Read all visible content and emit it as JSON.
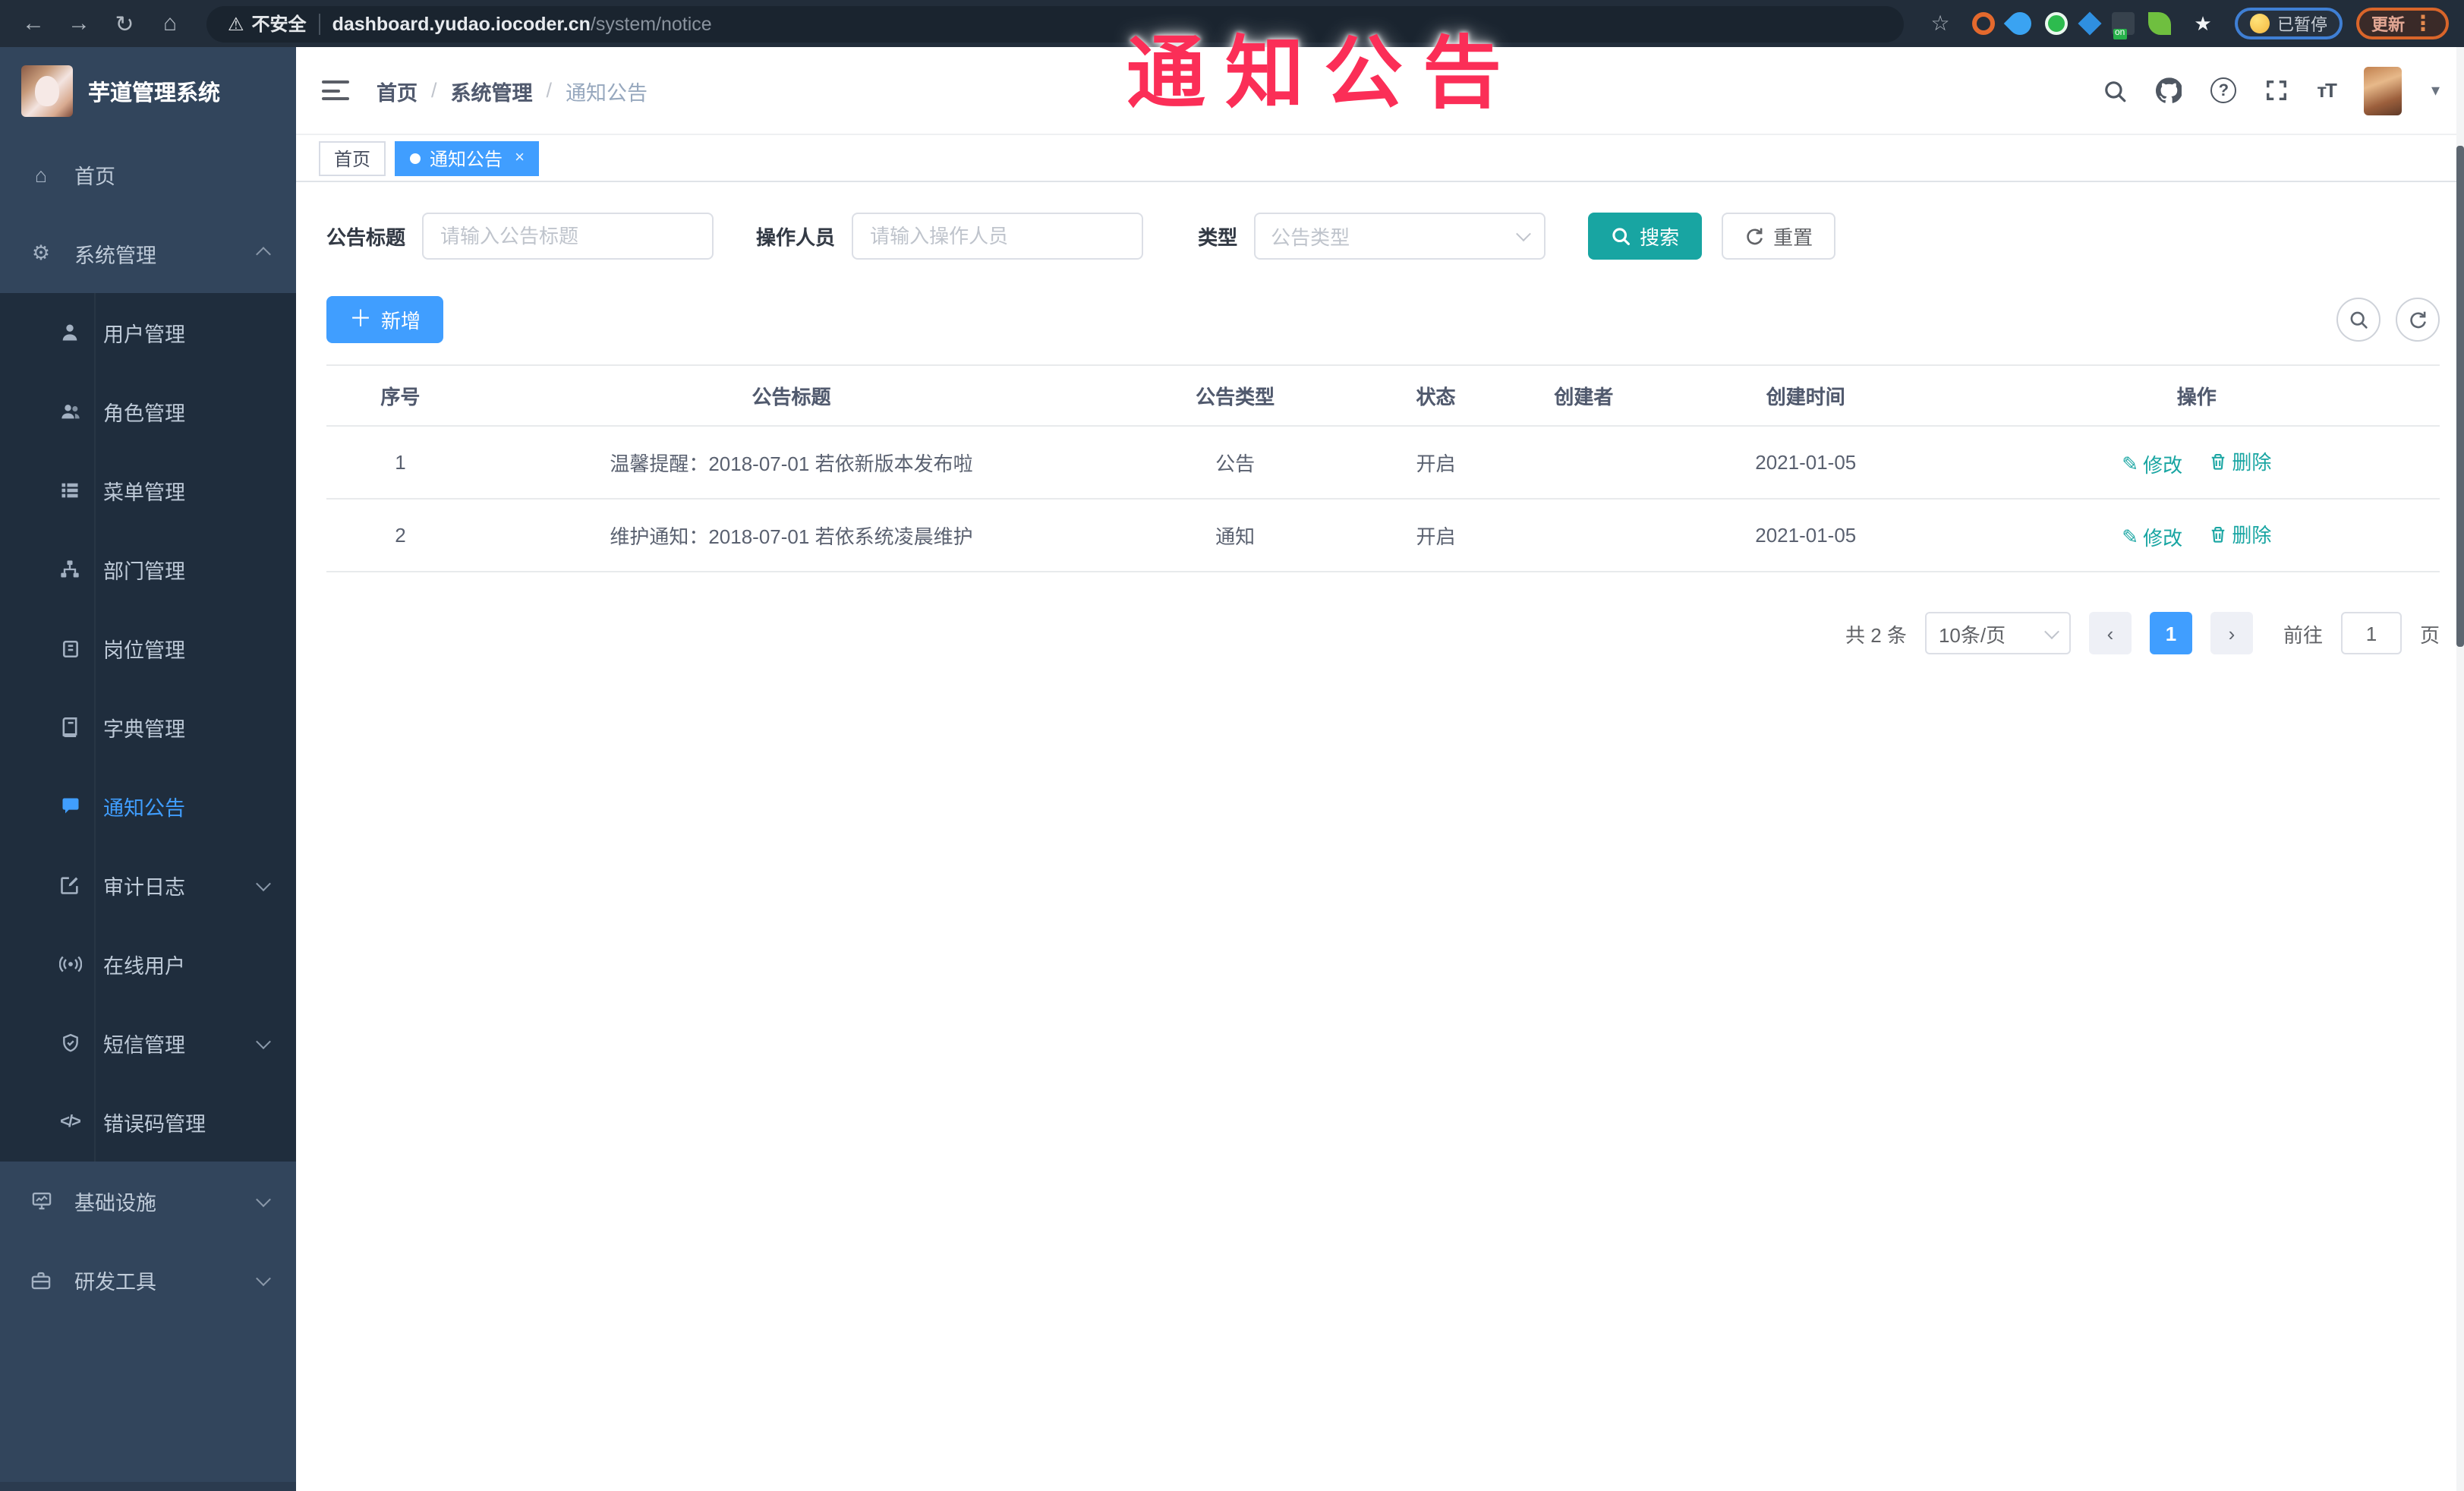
{
  "watermark": {
    "text": "通知公告"
  },
  "browser": {
    "security_label": "不安全",
    "url_host": "dashboard.yudao.iocoder.cn",
    "url_path": "/system/notice",
    "paused_badge": "已暂停",
    "update_button": "更新"
  },
  "sidebar": {
    "app_title": "芋道管理系统",
    "items": [
      {
        "label": "首页",
        "icon": "home-icon"
      },
      {
        "label": "系统管理",
        "icon": "gear-icon",
        "state": "expanded"
      },
      {
        "label": "用户管理",
        "icon": "user-icon"
      },
      {
        "label": "角色管理",
        "icon": "role-icon"
      },
      {
        "label": "菜单管理",
        "icon": "menu-list-icon"
      },
      {
        "label": "部门管理",
        "icon": "org-tree-icon"
      },
      {
        "label": "岗位管理",
        "icon": "post-icon"
      },
      {
        "label": "字典管理",
        "icon": "dict-icon"
      },
      {
        "label": "通知公告",
        "icon": "notice-icon",
        "state": "active"
      },
      {
        "label": "审计日志",
        "icon": "audit-log-icon",
        "state": "collapsed"
      },
      {
        "label": "在线用户",
        "icon": "online-user-icon"
      },
      {
        "label": "短信管理",
        "icon": "sms-icon",
        "state": "collapsed"
      },
      {
        "label": "错误码管理",
        "icon": "error-code-icon"
      },
      {
        "label": "基础设施",
        "icon": "infra-icon",
        "state": "collapsed"
      },
      {
        "label": "研发工具",
        "icon": "devtool-icon",
        "state": "collapsed"
      }
    ]
  },
  "header": {
    "breadcrumb": [
      "首页",
      "系统管理",
      "通知公告"
    ],
    "separator": "/"
  },
  "tabs": {
    "home": "首页",
    "active": "通知公告",
    "close": "×"
  },
  "filters": {
    "title_label": "公告标题",
    "title_placeholder": "请输入公告标题",
    "operator_label": "操作人员",
    "operator_placeholder": "请输入操作人员",
    "type_label": "类型",
    "type_placeholder": "公告类型",
    "search_label": "搜索",
    "reset_label": "重置"
  },
  "toolbar": {
    "add_label": "新增"
  },
  "table": {
    "headers": [
      "序号",
      "公告标题",
      "公告类型",
      "状态",
      "创建者",
      "创建时间",
      "操作"
    ],
    "rows": [
      {
        "index": "1",
        "title": "温馨提醒：2018-07-01 若依新版本发布啦",
        "type": "公告",
        "status": "开启",
        "creator": "",
        "created_at": "2021-01-05",
        "edit": "修改",
        "delete": "删除"
      },
      {
        "index": "2",
        "title": "维护通知：2018-07-01 若依系统凌晨维护",
        "type": "通知",
        "status": "开启",
        "creator": "",
        "created_at": "2021-01-05",
        "edit": "修改",
        "delete": "删除"
      }
    ]
  },
  "pagination": {
    "total": "共 2 条",
    "page_size": "10条/页",
    "prev": "‹",
    "next": "›",
    "page": "1",
    "goto_label": "前往",
    "goto_value": "1",
    "unit": "页"
  },
  "colors": {
    "accent_blue": "#409eff",
    "teal": "#18a5a2",
    "watermark_pink": "#fb2e57",
    "sidebar_bg": "#32455c",
    "submenu_bg": "#1f2d3d",
    "browser_bar": "#222d3a"
  }
}
